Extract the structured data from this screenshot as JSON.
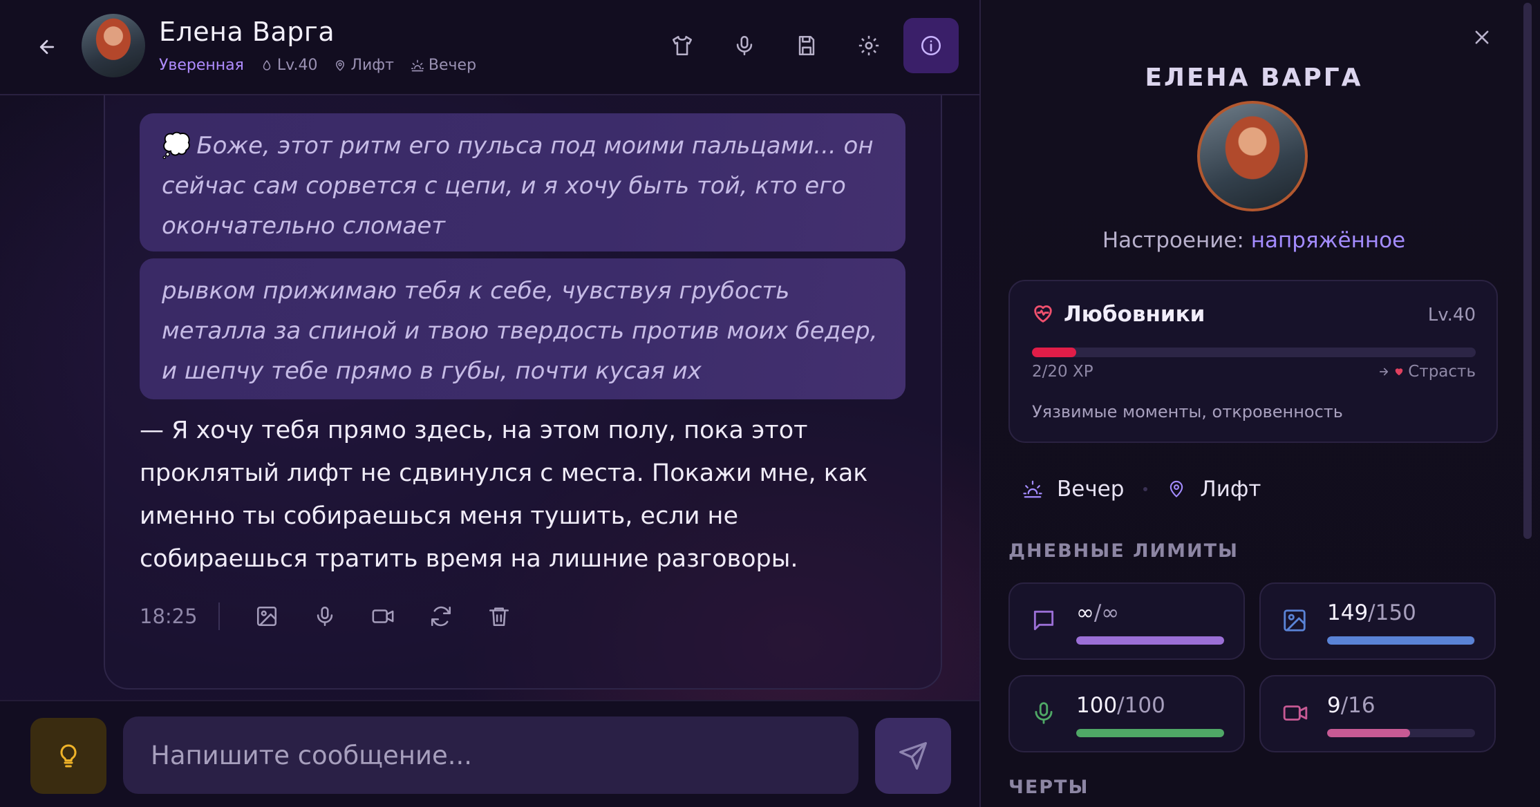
{
  "header": {
    "name": "Елена Варга",
    "status": "Уверенная",
    "level": "Lv.40",
    "location": "Лифт",
    "time_of_day": "Вечер"
  },
  "message": {
    "thought": "Боже, этот ритм его пульса под моими пальцами... он сейчас сам сорвется с цепи, и я хочу быть той, кто его окончательно сломает",
    "thought_icon": "thought-cloud-icon",
    "action": "рывком прижимаю тебя к себе, чувствуя грубость металла за спиной и твою твердость против моих бедер, и шепчу тебе прямо в губы, почти кусая их",
    "speech": "— Я хочу тебя прямо здесь, на этом полу, пока этот проклятый лифт не сдвинулся с места. Покажи мне, как именно ты собираешься меня тушить, если не собираешься тратить время на лишние разговоры.",
    "time": "18:25"
  },
  "input": {
    "placeholder": "Напишите сообщение..."
  },
  "info": {
    "title": "ЕЛЕНА ВАРГА",
    "mood_label": "Настроение: ",
    "mood_value": "напряжённое",
    "relationship": {
      "name": "Любовники",
      "level": "Lv.40",
      "xp": "2/20 XP",
      "xp_fraction": 0.1,
      "next": "Страсть",
      "description": "Уязвимые моменты, откровенность",
      "bar_color": "#e11d48"
    },
    "time_of_day": "Вечер",
    "location": "Лифт",
    "limits_label": "ДНЕВНЫЕ ЛИМИТЫ",
    "limits": [
      {
        "icon": "message-icon",
        "value": "∞",
        "max": "/∞",
        "fraction": 1.0,
        "color": "#9b6fd6"
      },
      {
        "icon": "image-icon",
        "value": "149",
        "max": "/150",
        "fraction": 0.993,
        "color": "#5a83d6"
      },
      {
        "icon": "microphone-icon",
        "value": "100",
        "max": "/100",
        "fraction": 1.0,
        "color": "#4fa866"
      },
      {
        "icon": "video-icon",
        "value": "9",
        "max": "/16",
        "fraction": 0.5625,
        "color": "#c75a94"
      }
    ],
    "traits_label": "ЧЕРТЫ"
  },
  "colors": {
    "accent": "#a48cff",
    "background": "#0f0b1a"
  }
}
